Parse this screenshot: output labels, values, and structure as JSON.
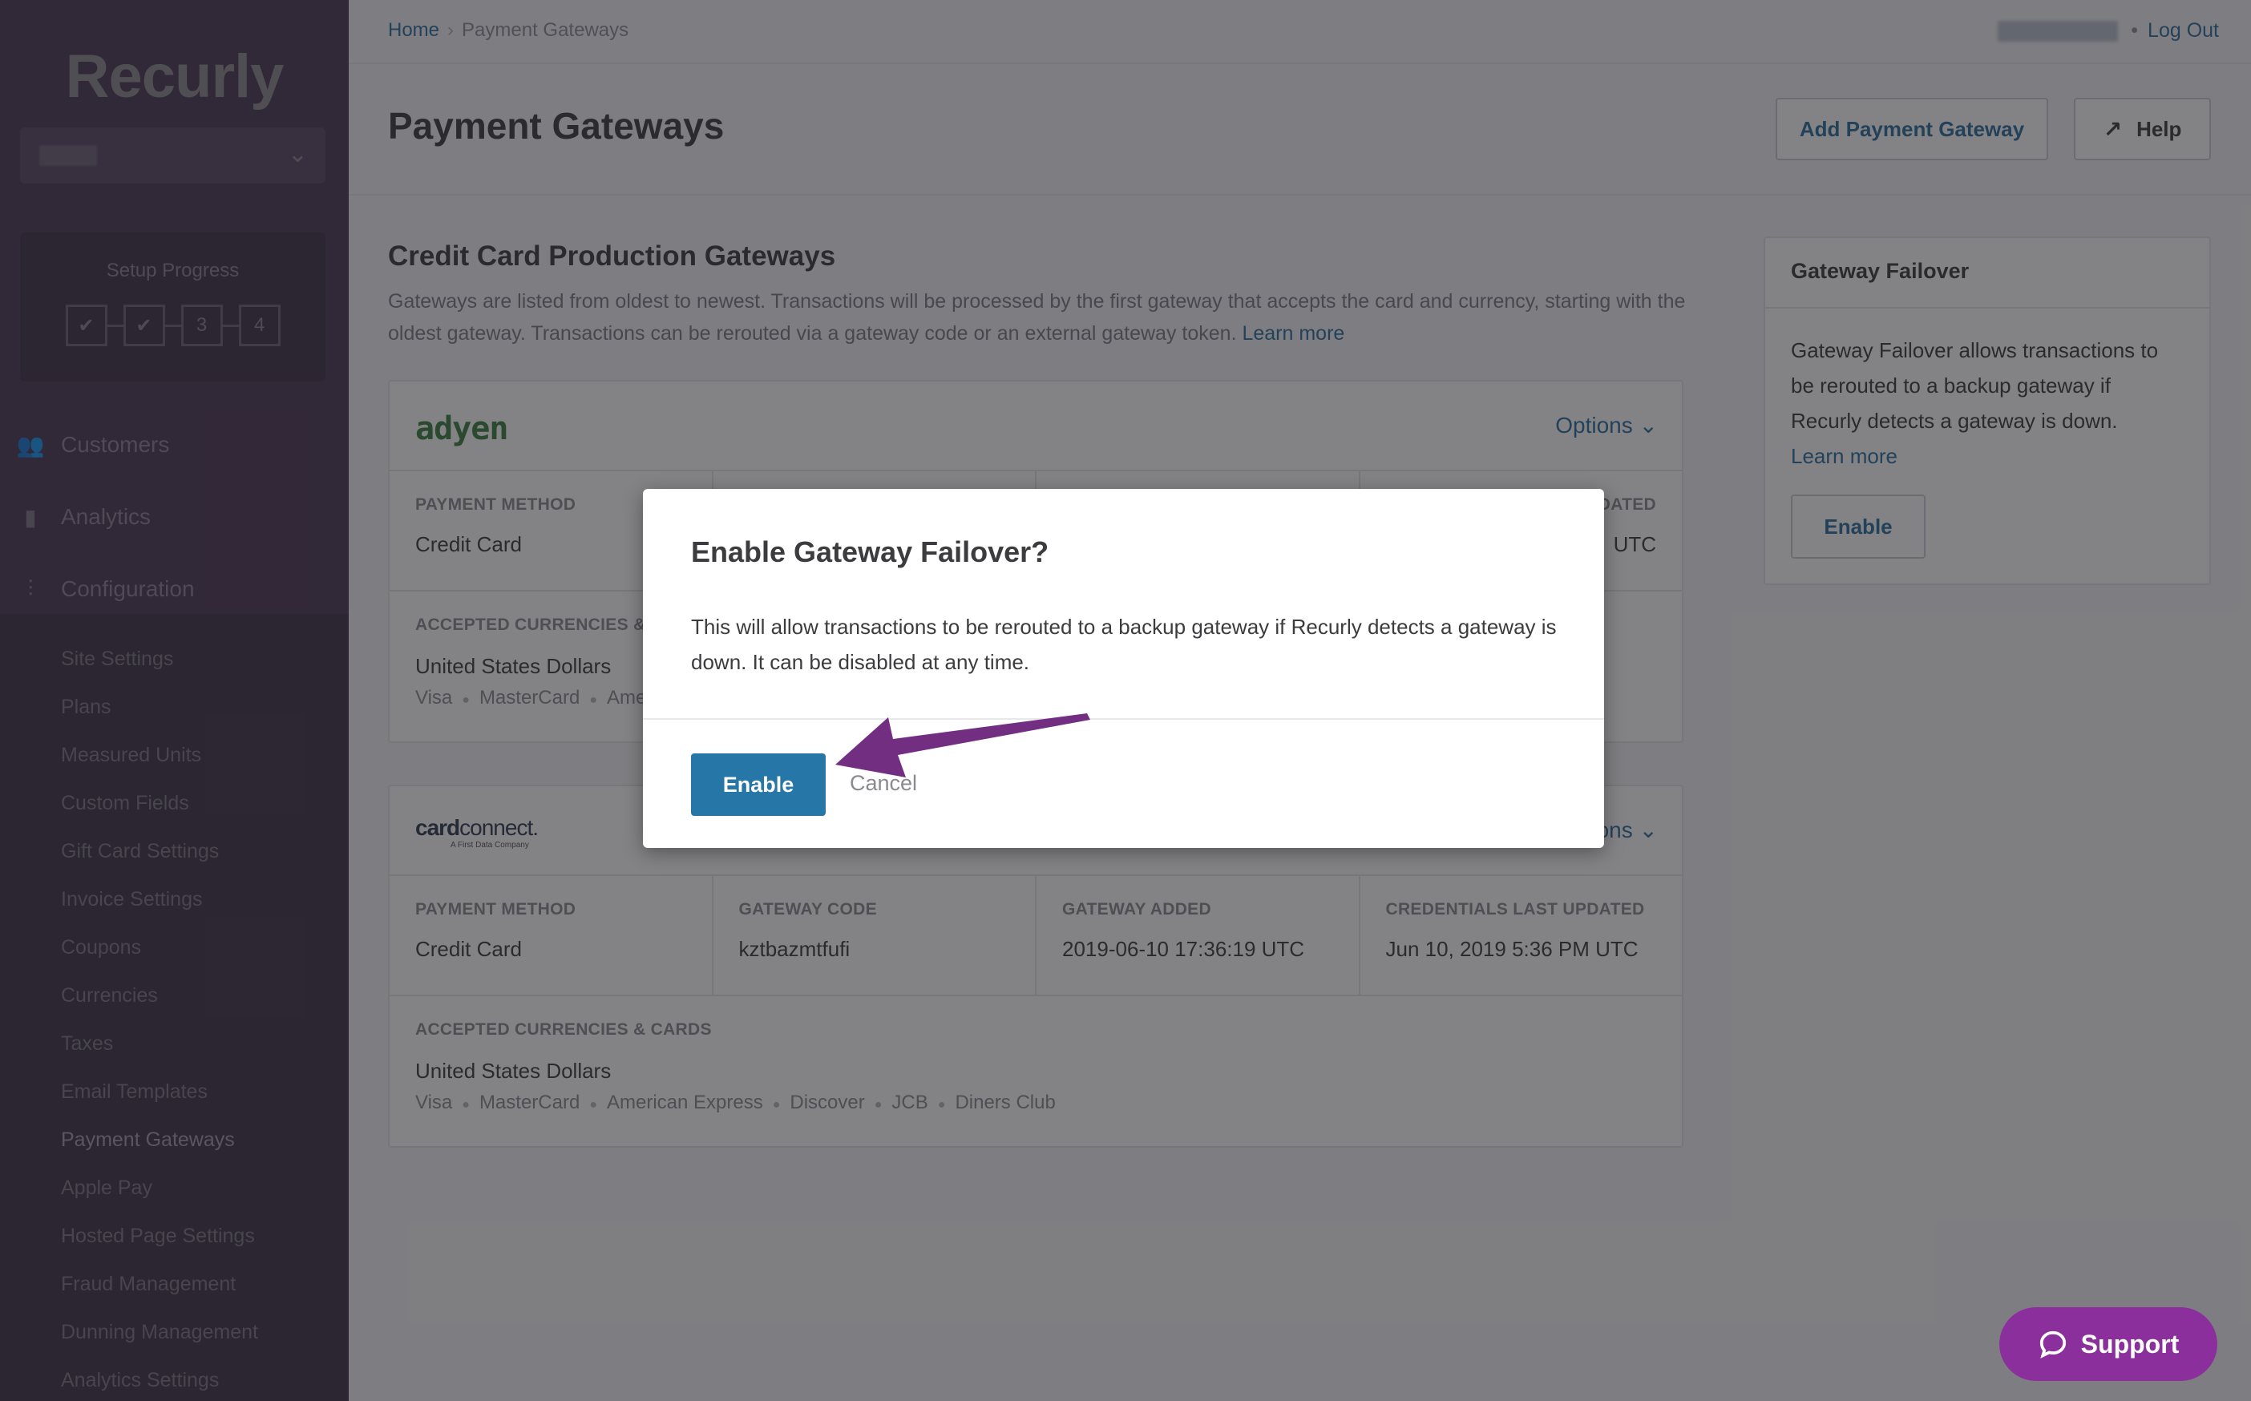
{
  "brand": {
    "name": "Recurly"
  },
  "sidebar": {
    "site_selector": {
      "value": "(redacted)"
    },
    "setup_progress": {
      "title": "Setup Progress",
      "steps": [
        {
          "label": "✔",
          "completed": true
        },
        {
          "label": "✔",
          "completed": true
        },
        {
          "label": "3",
          "completed": false
        },
        {
          "label": "4",
          "completed": false
        }
      ]
    },
    "main_items": [
      {
        "label": "Customers",
        "icon": "users-icon"
      },
      {
        "label": "Analytics",
        "icon": "bar-chart-icon"
      },
      {
        "label": "Configuration",
        "icon": "sliders-icon"
      }
    ],
    "config_items": [
      {
        "label": "Site Settings"
      },
      {
        "label": "Plans"
      },
      {
        "label": "Measured Units"
      },
      {
        "label": "Custom Fields"
      },
      {
        "label": "Gift Card Settings"
      },
      {
        "label": "Invoice Settings"
      },
      {
        "label": "Coupons"
      },
      {
        "label": "Currencies"
      },
      {
        "label": "Taxes"
      },
      {
        "label": "Email Templates"
      },
      {
        "label": "Payment Gateways",
        "active": true
      },
      {
        "label": "Apple Pay"
      },
      {
        "label": "Hosted Page Settings"
      },
      {
        "label": "Fraud Management"
      },
      {
        "label": "Dunning Management"
      },
      {
        "label": "Analytics Settings"
      }
    ]
  },
  "topbar": {
    "breadcrumb": {
      "home": "Home",
      "separator": "›",
      "current": "Payment Gateways"
    },
    "user_bullet": "•",
    "logout": "Log Out"
  },
  "header": {
    "title": "Payment Gateways",
    "add_button": "Add Payment Gateway",
    "help_button": "Help"
  },
  "section": {
    "title": "Credit Card Production Gateways",
    "description": "Gateways are listed from oldest to newest. Transactions will be processed by the first gateway that accepts the card and currency, starting with the oldest gateway. Transactions can be rerouted via a gateway code or an external gateway token.",
    "learn_more": "Learn more"
  },
  "gateways": [
    {
      "logo": "adyen",
      "options_label": "Options",
      "columns": [
        {
          "label": "Payment Method",
          "value": "Credit Card"
        },
        {
          "label": "",
          "value": ""
        },
        {
          "label": "",
          "value": ""
        },
        {
          "label": "Credentials Last Updated",
          "value": "UTC"
        }
      ],
      "currencies_label": "Accepted Currencies & Cards",
      "currency": "United States Dollars",
      "cards": [
        "Visa",
        "MasterCard",
        "American Express"
      ]
    },
    {
      "logo_main_bold": "card",
      "logo_main": "connect.",
      "logo_sub": "A First Data Company",
      "options_label": "Options",
      "columns": [
        {
          "label": "Payment Method",
          "value": "Credit Card"
        },
        {
          "label": "Gateway Code",
          "value": "kztbazmtfufi"
        },
        {
          "label": "Gateway Added",
          "value": "2019-06-10 17:36:19 UTC"
        },
        {
          "label": "Credentials Last Updated",
          "value": "Jun 10, 2019 5:36 PM UTC"
        }
      ],
      "currencies_label": "Accepted Currencies & Cards",
      "currency": "United States Dollars",
      "cards": [
        "Visa",
        "MasterCard",
        "American Express",
        "Discover",
        "JCB",
        "Diners Club"
      ]
    }
  ],
  "failover_panel": {
    "title": "Gateway Failover",
    "body": "Gateway Failover allows transactions to be rerouted to a backup gateway if Recurly detects a gateway is down.",
    "learn_more": "Learn more",
    "enable_button": "Enable"
  },
  "modal": {
    "title": "Enable Gateway Failover?",
    "body": "This will allow transactions to be rerouted to a backup gateway if Recurly detects a gateway is down. It can be disabled at any time.",
    "confirm_button": "Enable",
    "cancel_button": "Cancel"
  },
  "support": {
    "label": "Support"
  },
  "colors": {
    "accent": "#2677a7",
    "link": "#2c6e9b",
    "sidebar": "#4a3552",
    "support": "#8a2f9b",
    "annotation_arrow": "#722f82"
  }
}
